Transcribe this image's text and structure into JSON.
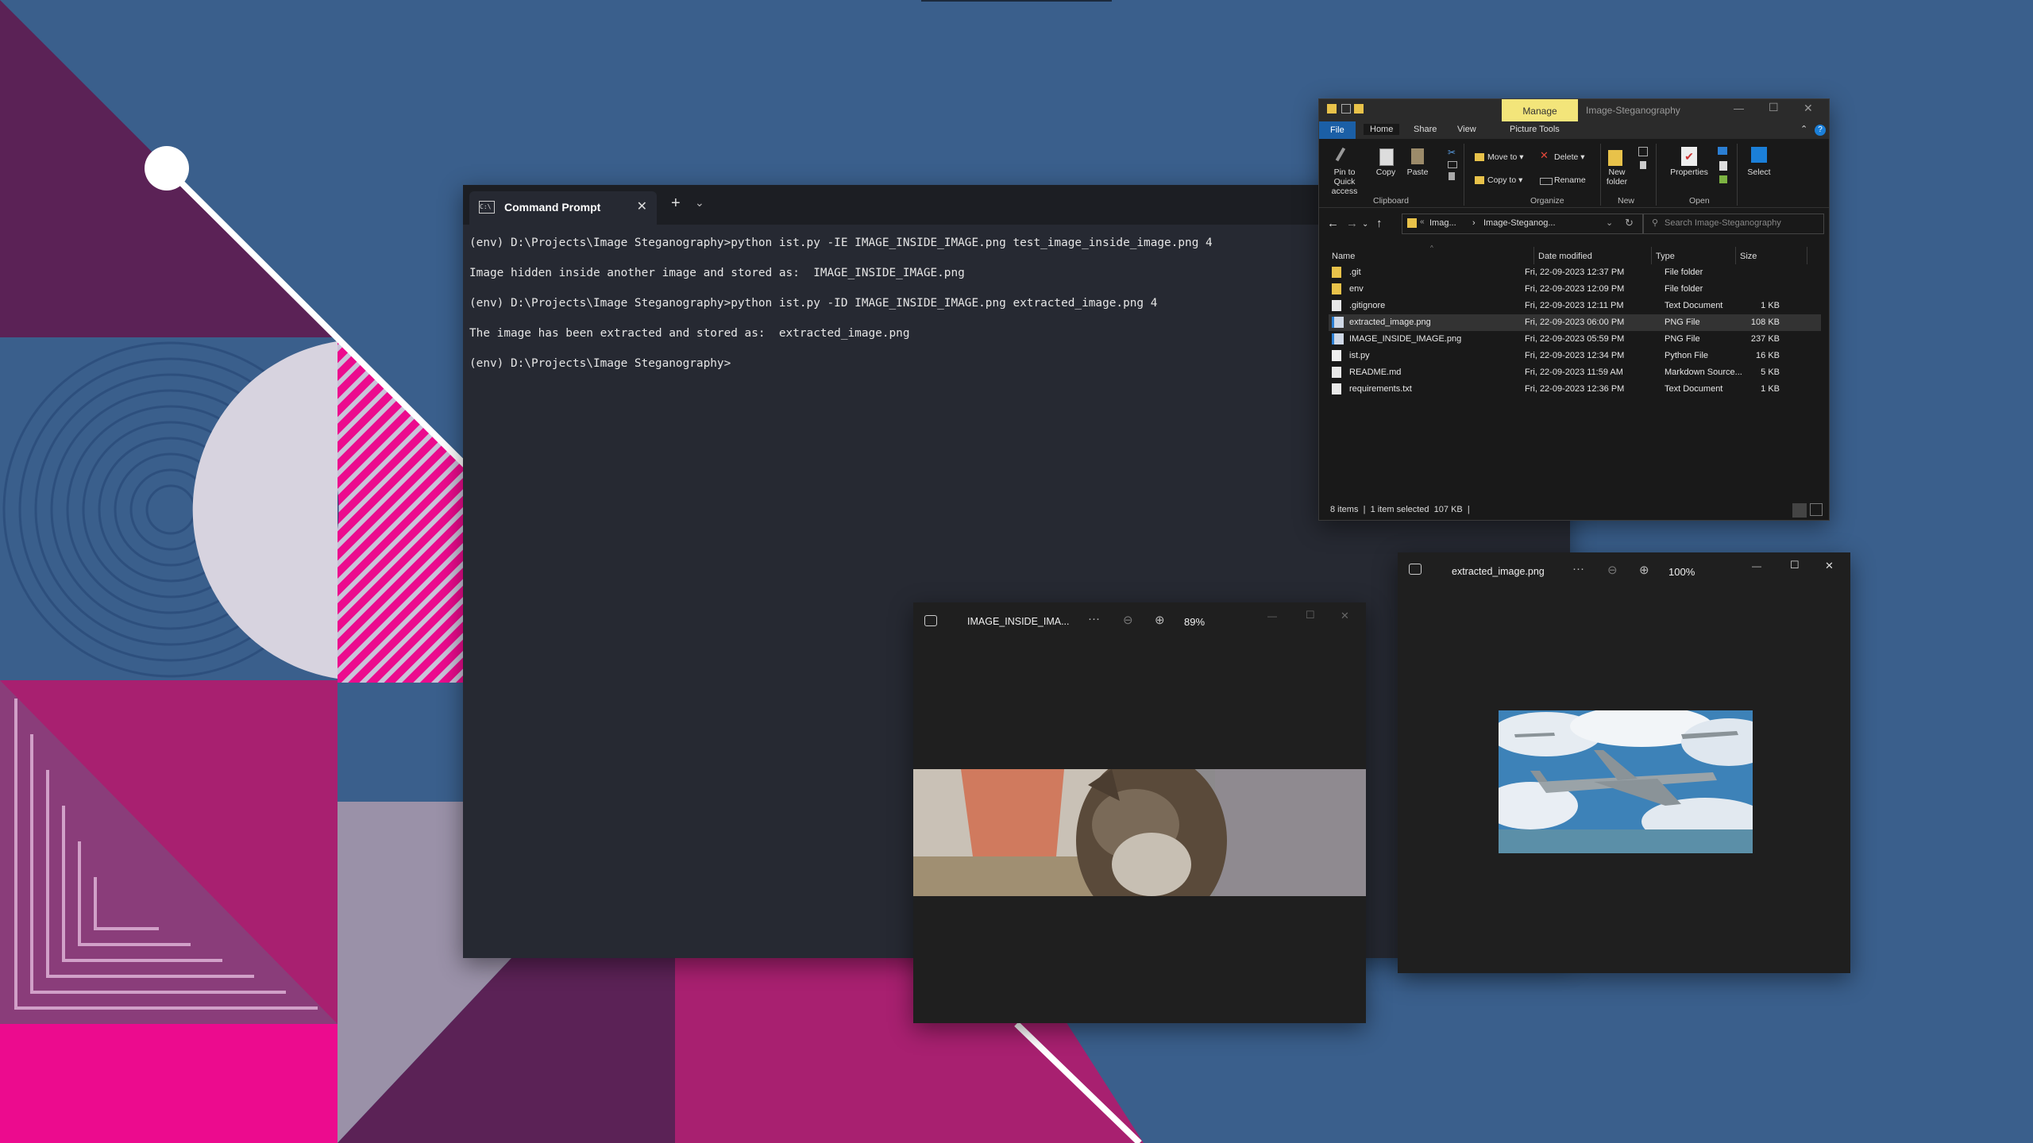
{
  "colors": {
    "desktop_blue": "#3a5f8c",
    "desktop_purple": "#5b2256",
    "desktop_magenta": "#a82070",
    "desktop_pink": "#ec0b8e",
    "terminal_bg": "#262932",
    "explorer_bg": "#191919",
    "manage_tab": "#f3e57a",
    "selection": "#333333"
  },
  "cmd": {
    "tab_title": "Command Prompt",
    "close_glyph": "✕",
    "new_tab_glyph": "+",
    "dropdown_glyph": "⌄",
    "lines": [
      "(env) D:\\Projects\\Image Steganography>python ist.py -IE IMAGE_INSIDE_IMAGE.png test_image_inside_image.png 4",
      "Image hidden inside another image and stored as:  IMAGE_INSIDE_IMAGE.png",
      "(env) D:\\Projects\\Image Steganography>python ist.py -ID IMAGE_INSIDE_IMAGE.png extracted_image.png 4",
      "The image has been extracted and stored as:  extracted_image.png",
      "(env) D:\\Projects\\Image Steganography>"
    ]
  },
  "explorer": {
    "manage_label": "Manage",
    "window_title": "Image-Steganography",
    "menu": {
      "file": "File",
      "home": "Home",
      "share": "Share",
      "view": "View",
      "picture_tools": "Picture Tools"
    },
    "ribbon": {
      "pin_line1": "Pin to Quick",
      "pin_line2": "access",
      "copy": "Copy",
      "paste": "Paste",
      "move_to": "Move to ▾",
      "copy_to": "Copy to ▾",
      "delete": "Delete ▾",
      "rename": "Rename",
      "new_folder_line1": "New",
      "new_folder_line2": "folder",
      "properties": "Properties",
      "select": "Select",
      "groups": {
        "clipboard": "Clipboard",
        "organize": "Organize",
        "new": "New",
        "open": "Open"
      }
    },
    "address_crumb1": "Imag...",
    "address_crumb2": "Image-Steganog...",
    "search_placeholder": "Search Image-Steganography",
    "columns": {
      "name": "Name",
      "date": "Date modified",
      "type": "Type",
      "size": "Size"
    },
    "files": [
      {
        "name": ".git",
        "date": "Fri, 22-09-2023 12:37 PM",
        "type": "File folder",
        "size": "",
        "icon": "folder-icon"
      },
      {
        "name": "env",
        "date": "Fri, 22-09-2023 12:09 PM",
        "type": "File folder",
        "size": "",
        "icon": "folder-icon"
      },
      {
        "name": ".gitignore",
        "date": "Fri, 22-09-2023 12:11 PM",
        "type": "Text Document",
        "size": "1 KB",
        "icon": "document-icon"
      },
      {
        "name": "extracted_image.png",
        "date": "Fri, 22-09-2023 06:00 PM",
        "type": "PNG File",
        "size": "108 KB",
        "icon": "image-file-icon"
      },
      {
        "name": "IMAGE_INSIDE_IMAGE.png",
        "date": "Fri, 22-09-2023 05:59 PM",
        "type": "PNG File",
        "size": "237 KB",
        "icon": "image-file-icon"
      },
      {
        "name": "ist.py",
        "date": "Fri, 22-09-2023 12:34 PM",
        "type": "Python File",
        "size": "16 KB",
        "icon": "python-file-icon"
      },
      {
        "name": "README.md",
        "date": "Fri, 22-09-2023 11:59 AM",
        "type": "Markdown Source...",
        "size": "5 KB",
        "icon": "document-icon"
      },
      {
        "name": "requirements.txt",
        "date": "Fri, 22-09-2023 12:36 PM",
        "type": "Text Document",
        "size": "1 KB",
        "icon": "document-icon"
      }
    ],
    "selected_index": 3,
    "status": {
      "items": "8 items",
      "selected": "1 item selected  107 KB"
    }
  },
  "photo1": {
    "title": "IMAGE_INSIDE_IMA...",
    "more": "···",
    "zoom": "89%"
  },
  "photo2": {
    "title": "extracted_image.png",
    "more": "···",
    "zoom": "100%"
  }
}
